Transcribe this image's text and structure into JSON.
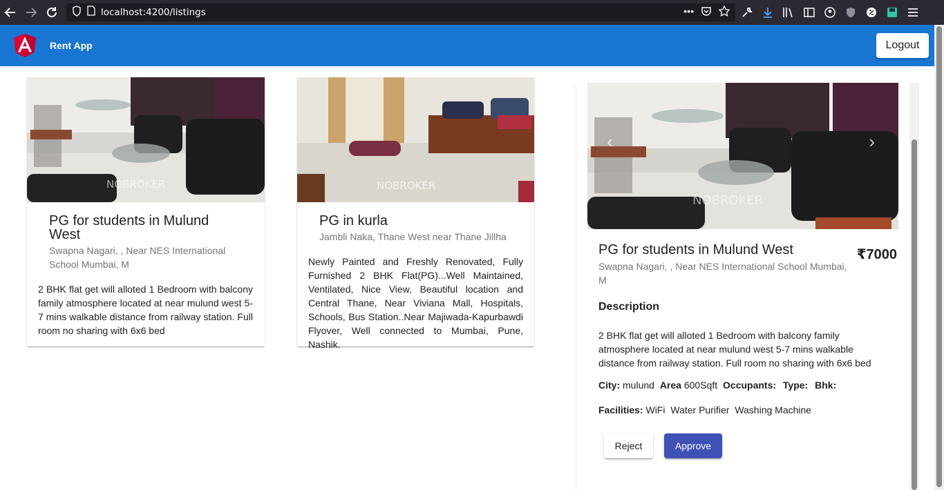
{
  "browser": {
    "url": "localhost:4200/listings"
  },
  "header": {
    "app_title": "Rent App",
    "logout_label": "Logout",
    "brand_color": "#1976d2"
  },
  "listings": [
    {
      "title": "PG for students in Mulund West",
      "address": "Swapna Nagari, , Near NES International School Mumbai, M",
      "description": "2 BHK flat get will alloted 1 Bedroom with balcony family atmosphere located at near mulund west 5-7 mins walkable distance from railway station. Full room no sharing with 6x6 bed",
      "image_watermark": "NOBROKER"
    },
    {
      "title": "PG in kurla",
      "address": "Jambli Naka, Thane West near Thane Jillha",
      "description": "Newly Painted and Freshly Renovated, Fully Furnished 2 BHK Flat(PG)...Well Maintained, Ventilated, Nice View, Beautiful location and Central Thane, Near Viviana Mall, Hospitals, Schools, Bus Station..Near Majiwada-Kapurbawdi Flyover, Well connected to Mumbai, Pune, Nashik.",
      "image_watermark": "NOBROKER"
    }
  ],
  "detail": {
    "title": "PG for students in Mulund West",
    "price": "₹7000",
    "address": "Swapna Nagari, , Near NES International School Mumbai, M",
    "description_heading": "Description",
    "description": "2 BHK flat get will alloted 1 Bedroom with balcony family atmosphere located at near mulund west 5-7 mins walkable distance from railway station. Full room no sharing with 6x6 bed",
    "city_label": "City:",
    "city": "mulund",
    "area_label": "Area",
    "area": "600Sqft",
    "occupants_label": "Occupants:",
    "type_label": "Type:",
    "bhk_label": "Bhk:",
    "facilities_label": "Facilities:",
    "facilities": [
      "WiFi",
      "Water Purifier",
      "Washing Machine"
    ],
    "image_watermark": "NOBROKER",
    "reject_label": "Reject",
    "approve_label": "Approve",
    "approve_color": "#3f51b5"
  }
}
